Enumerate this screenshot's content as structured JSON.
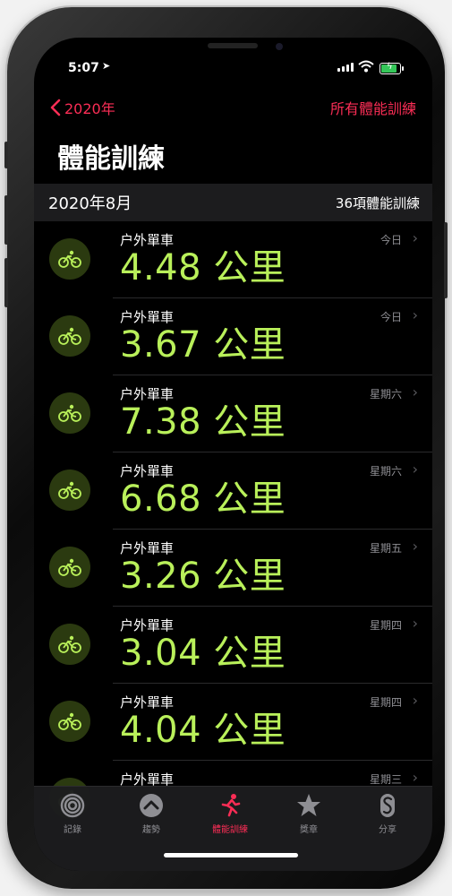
{
  "status": {
    "time": "5:07",
    "location_icon": "location-arrow-icon"
  },
  "nav": {
    "back_label": "2020年",
    "right_label": "所有體能訓練"
  },
  "title": "體能訓練",
  "section": {
    "month": "2020年8月",
    "count": "36項體能訓練"
  },
  "workouts": [
    {
      "type": "户外單車",
      "distance": "4.48 公里",
      "day": "今日"
    },
    {
      "type": "户外單車",
      "distance": "3.67 公里",
      "day": "今日"
    },
    {
      "type": "户外單車",
      "distance": "7.38 公里",
      "day": "星期六"
    },
    {
      "type": "户外單車",
      "distance": "6.68 公里",
      "day": "星期六"
    },
    {
      "type": "户外單車",
      "distance": "3.26 公里",
      "day": "星期五"
    },
    {
      "type": "户外單車",
      "distance": "3.04 公里",
      "day": "星期四"
    },
    {
      "type": "户外單車",
      "distance": "4.04 公里",
      "day": "星期四"
    },
    {
      "type": "户外單車",
      "distance": "",
      "day": "星期三"
    }
  ],
  "tabs": [
    {
      "label": "記錄",
      "icon": "activity-rings-icon"
    },
    {
      "label": "趨勢",
      "icon": "trends-icon"
    },
    {
      "label": "體能訓練",
      "icon": "running-figure-icon"
    },
    {
      "label": "獎章",
      "icon": "award-star-icon"
    },
    {
      "label": "分享",
      "icon": "sharing-icon"
    }
  ],
  "colors": {
    "accent": "#fa2d55",
    "distance": "#b9f05a",
    "icon_bg": "#2b3a10"
  }
}
